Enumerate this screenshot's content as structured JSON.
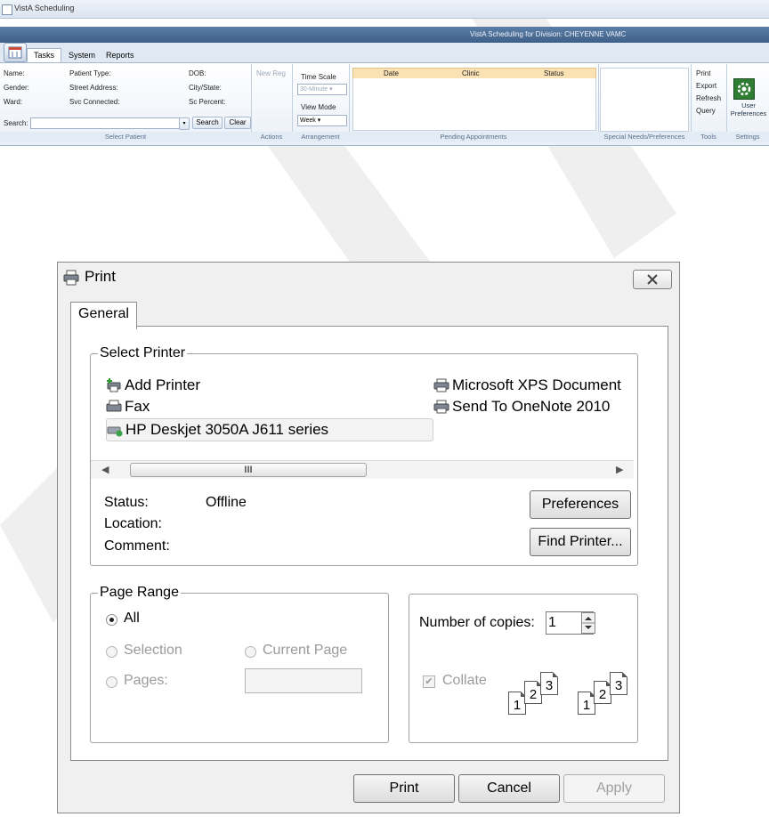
{
  "vista": {
    "title": "VistA Scheduling",
    "division_banner": "VistA Scheduling for Division: CHEYENNE VAMC",
    "tabs": [
      "Tasks",
      "System",
      "Reports"
    ],
    "patient": {
      "name_label": "Name:",
      "gender_label": "Gender:",
      "ward_label": "Ward:",
      "patient_type_label": "Patient Type:",
      "street_label": "Street Address:",
      "svc_label": "Svc Connected:",
      "dob_label": "DOB:",
      "city_label": "City/State:",
      "sc_percent_label": "Sc Percent:",
      "search_label": "Search:",
      "search_button": "Search",
      "clear_button": "Clear",
      "group_label": "Select Patient"
    },
    "actions": {
      "new_reg": "New Reg",
      "group_label": "Actions"
    },
    "arrangement": {
      "time_scale_label": "Time Scale",
      "time_scale_value": "30-Minute",
      "view_mode_label": "View Mode",
      "view_mode_value": "Week",
      "group_label": "Arrangement"
    },
    "pending": {
      "columns": [
        "Date",
        "Clinic",
        "Status"
      ],
      "group_label": "Pending Appointments"
    },
    "special_needs": {
      "group_label": "Special Needs/Preferences"
    },
    "tools": {
      "items": [
        "Print",
        "Export",
        "Refresh",
        "Query"
      ],
      "group_label": "Tools"
    },
    "settings": {
      "button": "User Preferences",
      "group_label": "Settings"
    }
  },
  "dialog": {
    "title": "Print",
    "tab": "General",
    "select_printer": {
      "legend": "Select Printer",
      "printers": [
        {
          "name": "Add Printer",
          "icon": "add-printer-icon"
        },
        {
          "name": "Fax",
          "icon": "fax-icon"
        },
        {
          "name": "HP Deskjet 3050A J611 series",
          "icon": "network-printer-icon",
          "selected": true
        },
        {
          "name": "Microsoft XPS Document",
          "icon": "printer-icon"
        },
        {
          "name": "Send To OneNote 2010",
          "icon": "printer-icon"
        }
      ],
      "status_label": "Status:",
      "status_value": "Offline",
      "location_label": "Location:",
      "comment_label": "Comment:",
      "preferences_button": "Preferences",
      "find_printer_button": "Find Printer...",
      "scroll_thumb_glyph": "III"
    },
    "page_range": {
      "legend": "Page Range",
      "all": "All",
      "selection": "Selection",
      "current_page": "Current Page",
      "pages": "Pages:",
      "selected": "All"
    },
    "copies": {
      "label": "Number of copies:",
      "value": "1",
      "collate": "Collate",
      "collate_checked": true,
      "pages_glyphs": [
        "1",
        "2",
        "3"
      ]
    },
    "buttons": {
      "print": "Print",
      "cancel": "Cancel",
      "apply": "Apply"
    }
  }
}
